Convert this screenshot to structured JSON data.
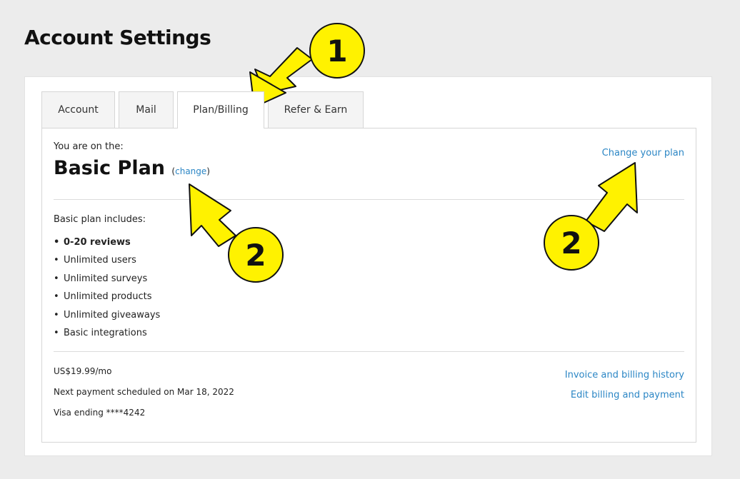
{
  "page": {
    "title": "Account Settings"
  },
  "tabs": [
    {
      "label": "Account"
    },
    {
      "label": "Mail"
    },
    {
      "label": "Plan/Billing",
      "active": true
    },
    {
      "label": "Refer & Earn"
    }
  ],
  "plan": {
    "intro": "You are on the:",
    "name": "Basic Plan",
    "change_open": "(",
    "change_link": "change",
    "change_close": ")",
    "change_plan_link": "Change your plan"
  },
  "includes": {
    "title": "Basic plan includes:",
    "items": [
      "0-20 reviews",
      "Unlimited users",
      "Unlimited surveys",
      "Unlimited products",
      "Unlimited giveaways",
      "Basic integrations"
    ]
  },
  "billing": {
    "price": "US$19.99/mo",
    "next_payment": "Next payment scheduled on Mar 18, 2022",
    "card": "Visa ending ****4242",
    "invoice_link": "Invoice and billing history",
    "edit_link": "Edit billing and payment"
  },
  "callouts": {
    "one": "1",
    "two_a": "2",
    "two_b": "2"
  },
  "colors": {
    "link": "#2b86c5",
    "callout_fill": "#fff200",
    "callout_stroke": "#111111",
    "background": "#ececec"
  }
}
